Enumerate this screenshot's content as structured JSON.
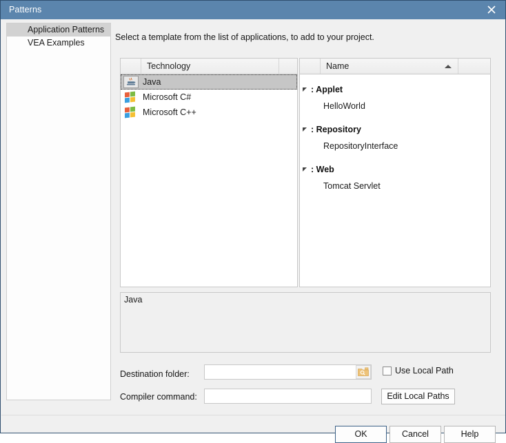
{
  "window": {
    "title": "Patterns",
    "close_icon": "close-icon",
    "titlebar_color": "#5b85ad"
  },
  "sidebar": {
    "items": [
      {
        "label": "Application Patterns",
        "selected": true
      },
      {
        "label": "VEA Examples",
        "selected": false
      }
    ]
  },
  "main": {
    "instruction": "Select a template from the list of applications, to add to your project."
  },
  "technology_panel": {
    "header": {
      "gutter": "",
      "column": "Technology",
      "tail": ""
    },
    "rows": [
      {
        "label": "Java",
        "icon": "java-icon",
        "selected": true
      },
      {
        "label": "Microsoft C#",
        "icon": "windows-icon",
        "selected": false
      },
      {
        "label": "Microsoft C++",
        "icon": "windows-icon",
        "selected": false
      }
    ]
  },
  "name_panel": {
    "header": {
      "gutter": "",
      "column": "Name",
      "sort_icon": "sort-ascending-icon",
      "tail": ""
    },
    "groups": [
      {
        "title": ": Applet",
        "items": [
          "HelloWorld"
        ]
      },
      {
        "title": ": Repository",
        "items": [
          "RepositoryInterface"
        ]
      },
      {
        "title": ": Web",
        "items": [
          "Tomcat Servlet"
        ]
      }
    ]
  },
  "description": {
    "text": "Java"
  },
  "form": {
    "destination_label": "Destination folder:",
    "destination_value": "",
    "destination_placeholder": "",
    "browse_icon": "folder-search-icon",
    "use_local_path_label": "Use Local Path",
    "use_local_path_checked": false,
    "compiler_label": "Compiler command:",
    "compiler_value": "",
    "compiler_placeholder": "",
    "edit_local_paths_label": "Edit Local Paths"
  },
  "footer": {
    "ok_label": "OK",
    "cancel_label": "Cancel",
    "help_label": "Help"
  }
}
